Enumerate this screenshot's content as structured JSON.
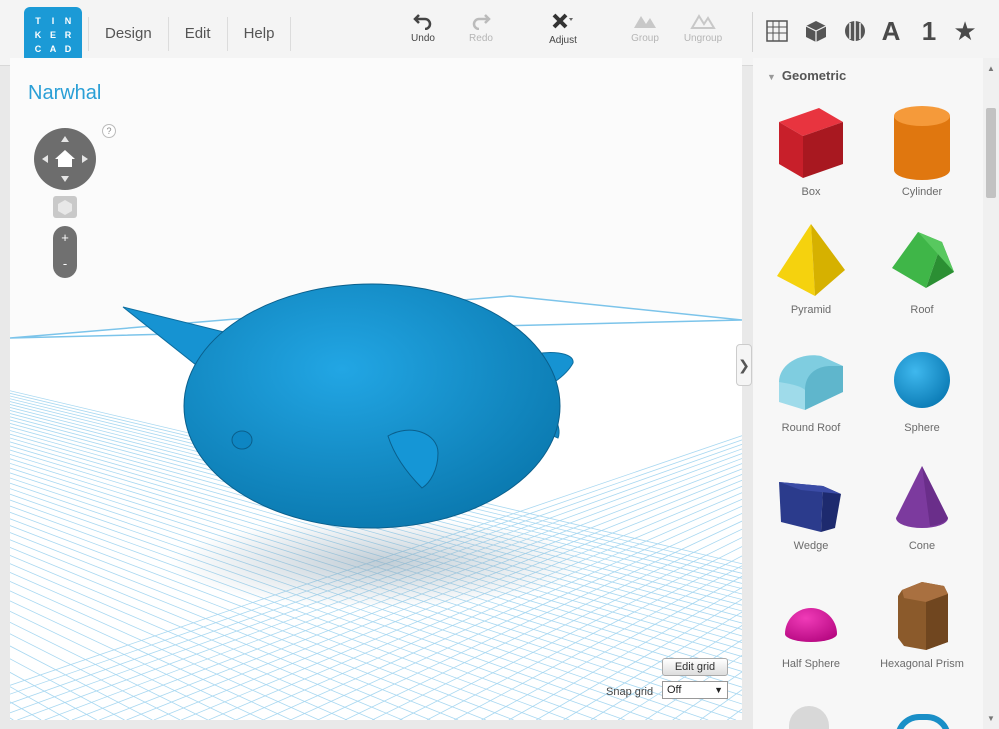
{
  "logo": {
    "letters": [
      "T",
      "I",
      "N",
      "K",
      "E",
      "R",
      "C",
      "A",
      "D"
    ]
  },
  "menu": {
    "items": [
      "Design",
      "Edit",
      "Help"
    ]
  },
  "toolbar": {
    "undo": "Undo",
    "redo": "Redo",
    "adjust": "Adjust",
    "group": "Group",
    "ungroup": "Ungroup"
  },
  "view_icons": [
    "grid-view-icon",
    "box-view-icon",
    "mesh-view-icon",
    "text-icon",
    "number-icon",
    "favorites-star-icon"
  ],
  "view_text": {
    "letter": "A",
    "number": "1",
    "star": "★"
  },
  "workplane": {
    "title": "Narwhal",
    "help": "?",
    "zoom_in": "+",
    "zoom_out": "-",
    "edit_grid": "Edit grid",
    "snap_grid_label": "Snap grid",
    "snap_grid_value": "Off",
    "collapse": "❯"
  },
  "colors": {
    "accent": "#2a9fd6",
    "model": "#1a8fc7",
    "grid": "#9fd2ee"
  },
  "panel": {
    "category": "Geometric",
    "shapes": [
      {
        "label": "Box"
      },
      {
        "label": "Cylinder"
      },
      {
        "label": "Pyramid"
      },
      {
        "label": "Roof"
      },
      {
        "label": "Round Roof"
      },
      {
        "label": "Sphere"
      },
      {
        "label": "Wedge"
      },
      {
        "label": "Cone"
      },
      {
        "label": "Half Sphere"
      },
      {
        "label": "Hexagonal Prism"
      }
    ]
  }
}
